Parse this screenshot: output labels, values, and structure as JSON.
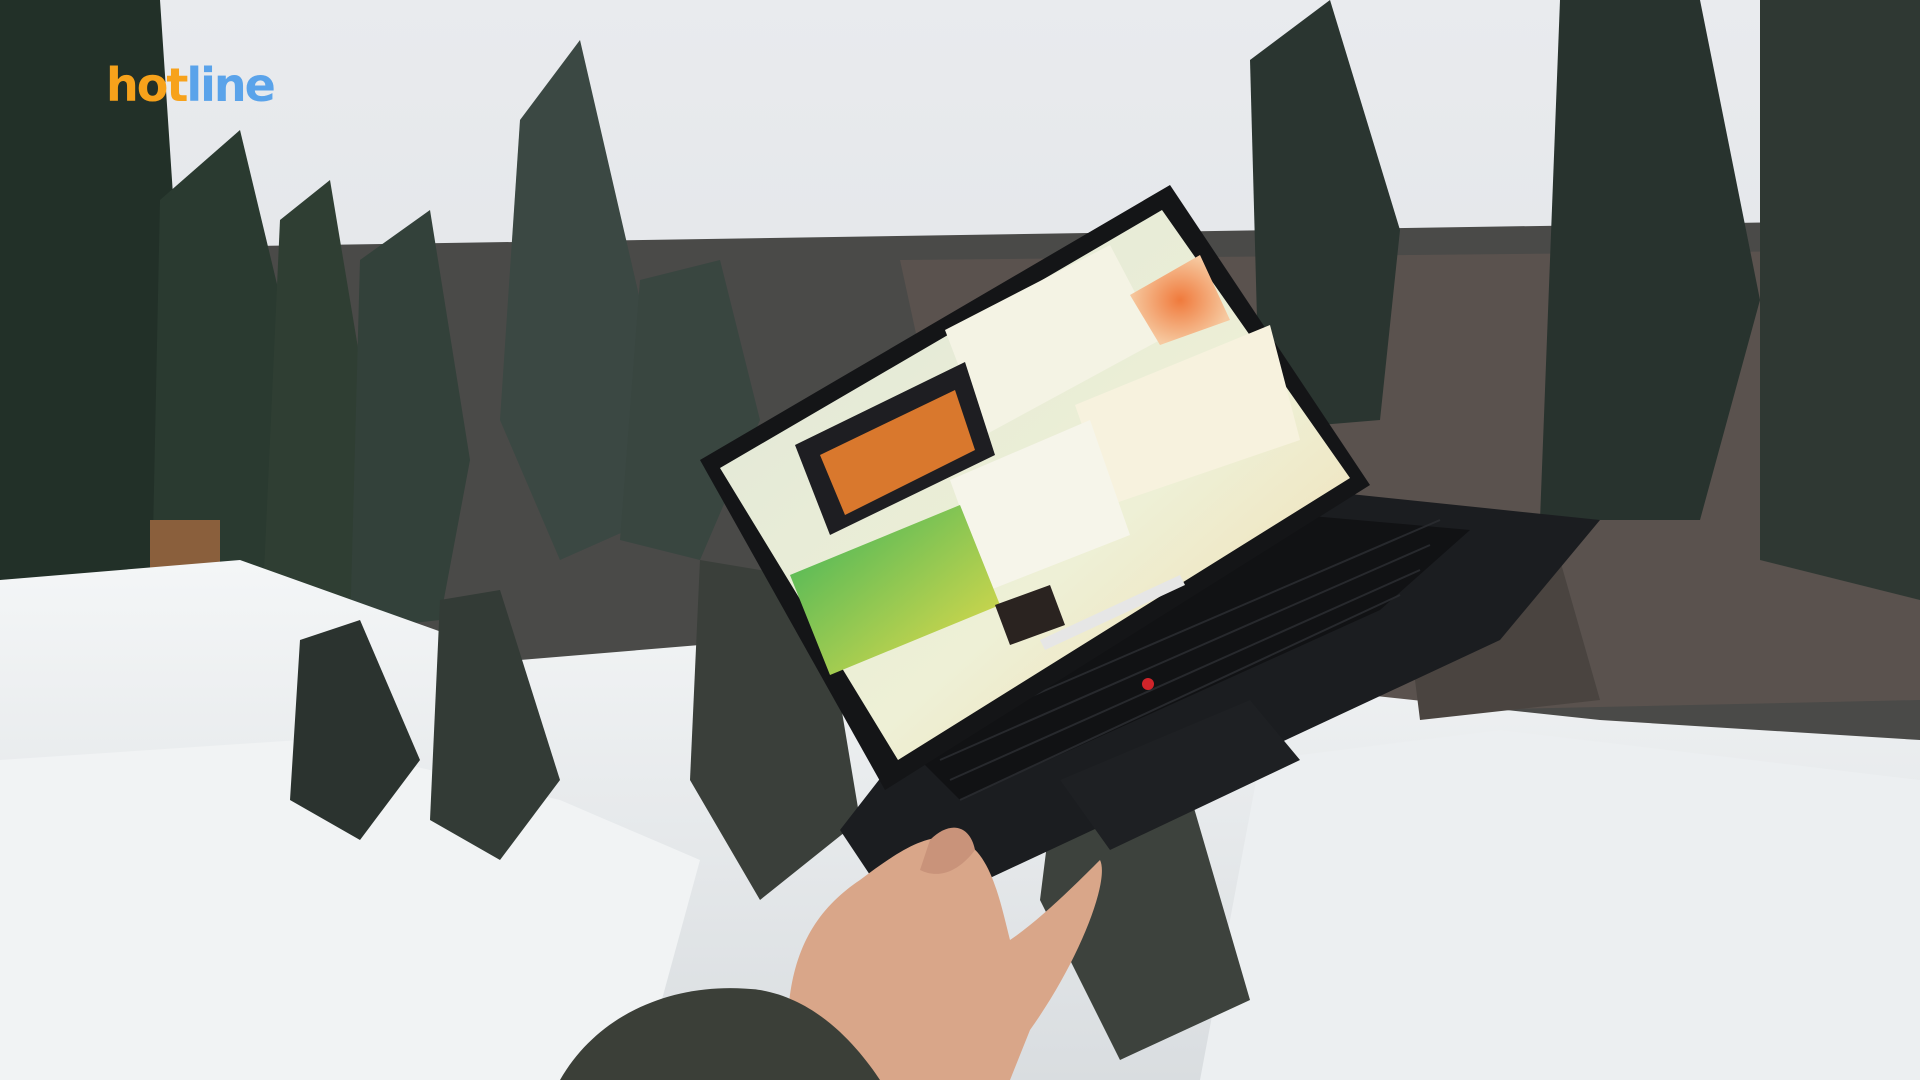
{
  "logo": {
    "part1": "hot",
    "part2": "line"
  },
  "colors": {
    "logo_orange": "#f7a21b",
    "logo_blue": "#5aa3ea",
    "laptop_body": "#16181b",
    "snow": "#eef1f3"
  },
  "scene": {
    "subject": "laptop",
    "icon": "thinkpad-laptop-icon"
  }
}
